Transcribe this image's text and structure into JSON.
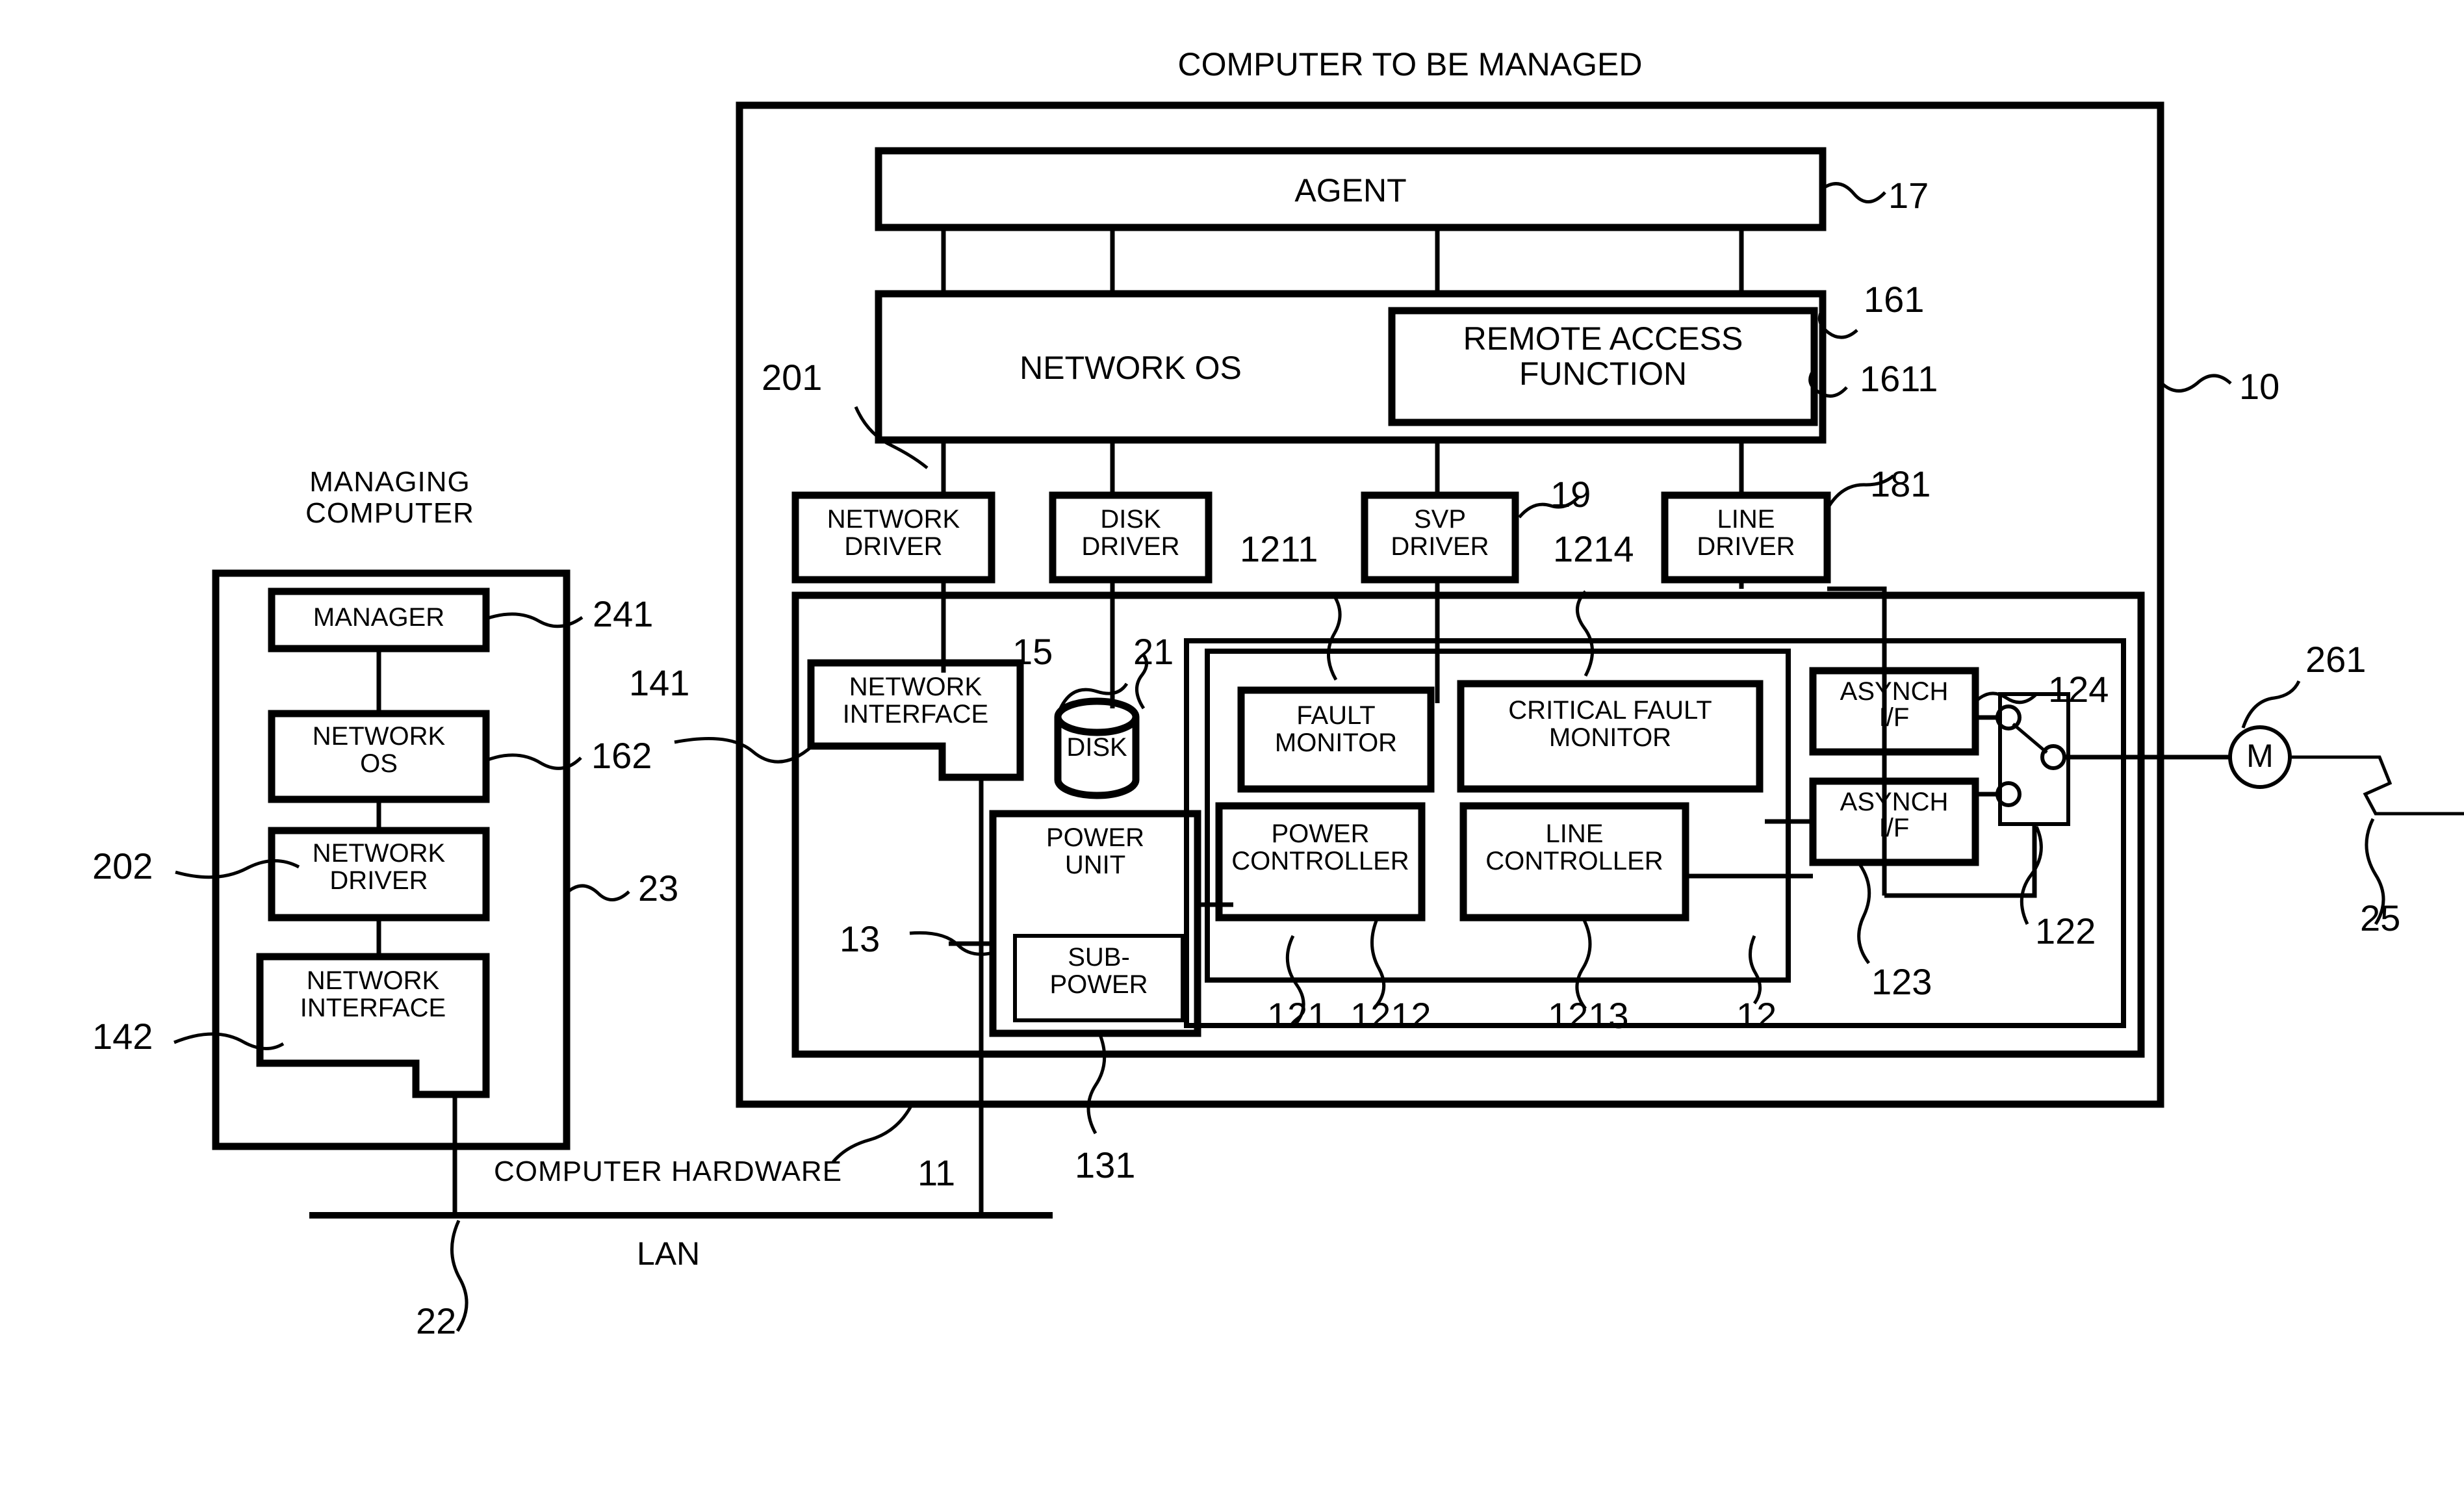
{
  "diagram": {
    "title_managed": "COMPUTER TO BE MANAGED",
    "title_managing_line1": "MANAGING",
    "title_managing_line2": "COMPUTER",
    "hardware_caption": "COMPUTER HARDWARE",
    "hardware_caption_num": "11",
    "lan_label": "LAN",
    "motor_symbol": "M"
  },
  "managed": {
    "agent": "AGENT",
    "network_os": "NETWORK OS",
    "remote_access_line1": "REMOTE ACCESS",
    "remote_access_line2": "FUNCTION",
    "drivers": [
      {
        "line1": "NETWORK",
        "line2": "DRIVER"
      },
      {
        "line1": "DISK",
        "line2": "DRIVER"
      },
      {
        "line1": "SVP",
        "line2": "DRIVER"
      },
      {
        "line1": "LINE",
        "line2": "DRIVER"
      }
    ],
    "network_interface_line1": "NETWORK",
    "network_interface_line2": "INTERFACE",
    "disk": "DISK",
    "power_unit_line1": "POWER",
    "power_unit_line2": "UNIT",
    "sub_power_line1": "SUB-",
    "sub_power_line2": "POWER",
    "fault_monitor_line1": "FAULT",
    "fault_monitor_line2": "MONITOR",
    "critical_fault_line1": "CRITICAL FAULT",
    "critical_fault_line2": "MONITOR",
    "power_controller_line1": "POWER",
    "power_controller_line2": "CONTROLLER",
    "line_controller_line1": "LINE",
    "line_controller_line2": "CONTROLLER",
    "asynch_if_line1": "ASYNCH",
    "asynch_if_line2": "I/F"
  },
  "managing": {
    "manager": "MANAGER",
    "network_os_line1": "NETWORK",
    "network_os_line2": "OS",
    "network_driver_line1": "NETWORK",
    "network_driver_line2": "DRIVER",
    "network_interface_line1": "NETWORK",
    "network_interface_line2": "INTERFACE"
  },
  "refs": {
    "r10": "10",
    "r11": "11",
    "r12": "12",
    "r13": "13",
    "r15": "15",
    "r17": "17",
    "r19": "19",
    "r21": "21",
    "r22": "22",
    "r23": "23",
    "r25": "25",
    "r121": "121",
    "r122": "122",
    "r123": "123",
    "r124": "124",
    "r131": "131",
    "r141": "141",
    "r142": "142",
    "r161": "161",
    "r162": "162",
    "r181": "181",
    "r201": "201",
    "r202": "202",
    "r241": "241",
    "r261": "261",
    "r1211": "1211",
    "r1212": "1212",
    "r1213": "1213",
    "r1214": "1214",
    "r1611": "1611"
  }
}
